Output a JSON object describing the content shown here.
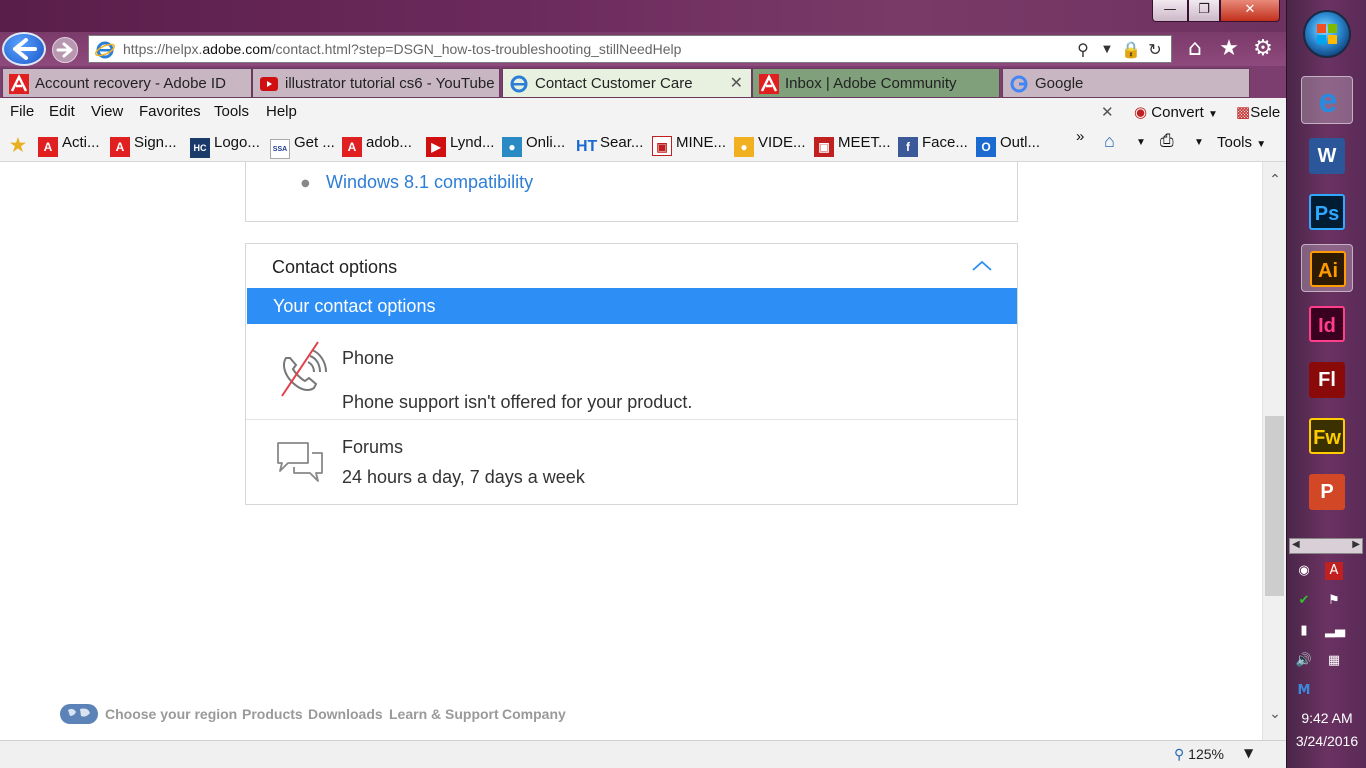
{
  "browser": {
    "url_prefix": "https://helpx.",
    "url_domain": "adobe.com",
    "url_path": "/contact.html?step=DSGN_how-tos-troubleshooting_stillNeedHelp",
    "tabs": [
      {
        "label": "Account recovery - Adobe ID",
        "icon": "adobe-icon"
      },
      {
        "label": "illustrator tutorial cs6 - YouTube",
        "icon": "youtube-icon"
      },
      {
        "label": "Contact Customer Care",
        "icon": "ie-icon",
        "active": true
      },
      {
        "label": "Inbox | Adobe Community",
        "icon": "adobe-icon"
      },
      {
        "label": "Google",
        "icon": "google-icon"
      }
    ],
    "menu": [
      "File",
      "Edit",
      "View",
      "Favorites",
      "Tools",
      "Help"
    ],
    "convert_label": "Convert",
    "select_label": "Sele",
    "favorites": [
      "Acti...",
      "Sign...",
      "Logo...",
      "Get ...",
      "adob...",
      "Lynd...",
      "Onli...",
      "Sear...",
      "MINE...",
      "VIDE...",
      "MEET...",
      "Face...",
      "Outl..."
    ],
    "tools_label": "Tools",
    "zoom": "125%"
  },
  "page": {
    "win81_link": "Windows 8.1 compatibility",
    "contact_title": "Contact options",
    "options_bar": "Your contact options",
    "phone": {
      "name": "Phone",
      "desc": "Phone support isn't offered for your product."
    },
    "forums": {
      "name": "Forums",
      "desc": "24 hours a day, 7 days a week"
    },
    "footer": [
      "Choose your region",
      "Products",
      "Downloads",
      "Learn & Support",
      "Company"
    ]
  },
  "taskbar": {
    "apps": [
      "Internet Explorer",
      "Word",
      "Ps",
      "Ai",
      "Id",
      "Fl",
      "Fw",
      "PowerPoint"
    ],
    "time": "9:42 AM",
    "date": "3/24/2016"
  },
  "colors": {
    "link": "#2d7ed6",
    "options_bar": "#2d8ef5",
    "phone_strike": "#e0414b"
  }
}
